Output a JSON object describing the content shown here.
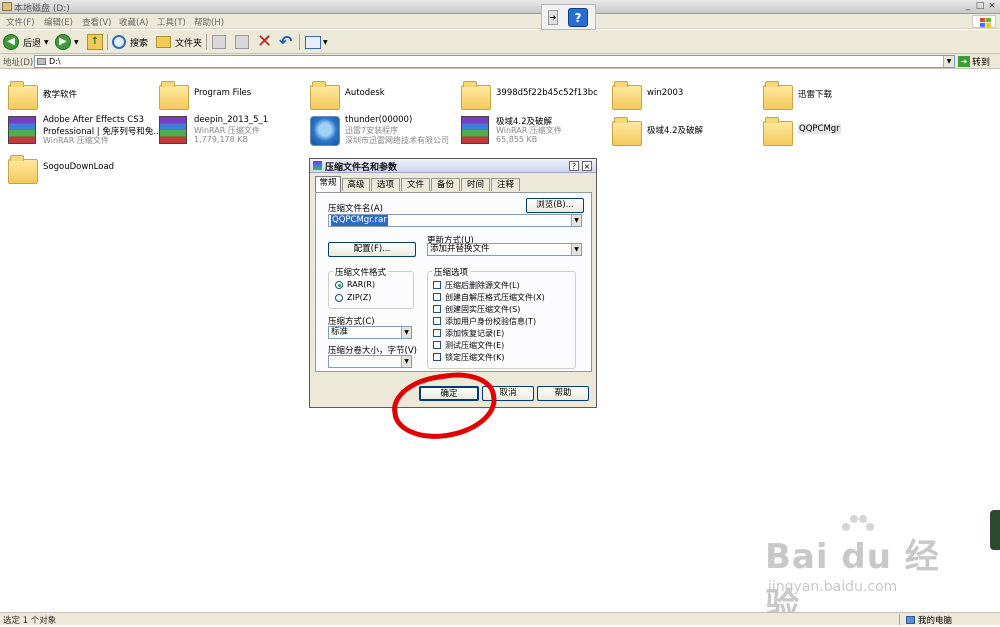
{
  "window": {
    "title": "本地磁盘 (D:)",
    "controls": [
      "_",
      "□",
      "×"
    ]
  },
  "menu": [
    "文件(F)",
    "编辑(E)",
    "查看(V)",
    "收藏(A)",
    "工具(T)",
    "帮助(H)"
  ],
  "toolbar": {
    "back_label": "后退",
    "search_label": "搜索",
    "folders_label": "文件夹"
  },
  "address": {
    "label": "地址(D)",
    "value": "D:\\",
    "go_label": "转到"
  },
  "files": [
    {
      "name": "教学软件",
      "type": "folder"
    },
    {
      "name": "Program Files",
      "type": "folder"
    },
    {
      "name": "Autodesk",
      "type": "folder"
    },
    {
      "name": "3998d5f22b45c52f13bc",
      "type": "folder"
    },
    {
      "name": "win2003",
      "type": "folder"
    },
    {
      "name": "迅雷下载",
      "type": "folder"
    },
    {
      "name": "Adobe After Effects CS3",
      "name2": "Professional | 免序列号和免...",
      "sub": "WinRAR 压缩文件",
      "type": "rar"
    },
    {
      "name": "deepin_2013_5_1",
      "sub": "WinRAR 压缩文件",
      "sub2": "1,779,178 KB",
      "type": "rar"
    },
    {
      "name": "thunder(00000)",
      "sub": "迅雷7安装程序",
      "sub2": "深圳市迅雷网络技术有限公司",
      "type": "thunder"
    },
    {
      "name": "极域4.2及破解",
      "sub": "WinRAR 压缩文件",
      "sub2": "65,855 KB",
      "type": "rar"
    },
    {
      "name": "极域4.2及破解",
      "type": "folder"
    },
    {
      "name": "QQPCMgr",
      "type": "folder"
    },
    {
      "name": "SogouDownLoad",
      "type": "folder"
    }
  ],
  "dialog": {
    "title": "压缩文件名和参数",
    "help_btn": "?",
    "close_btn": "×",
    "tabs": [
      "常规",
      "高级",
      "选项",
      "文件",
      "备份",
      "时间",
      "注释"
    ],
    "archive_name_label": "压缩文件名(A)",
    "browse_label": "浏览(B)...",
    "archive_name_value": "QQPCMgr.rar",
    "update_mode_label": "更新方式(U)",
    "update_mode_value": "添加并替换文件",
    "profiles_label": "配置(F)...",
    "format_group_label": "压缩文件格式",
    "format_rar": "RAR(R)",
    "format_zip": "ZIP(Z)",
    "method_label": "压缩方式(C)",
    "method_value": "标准",
    "volume_label": "压缩分卷大小，字节(V)",
    "volume_value": "",
    "options_group_label": "压缩选项",
    "options": [
      "压缩后删除源文件(L)",
      "创建自解压格式压缩文件(X)",
      "创建固实压缩文件(S)",
      "添加用户身份校验信息(T)",
      "添加恢复记录(E)",
      "测试压缩文件(E)",
      "锁定压缩文件(K)"
    ],
    "ok_label": "确定",
    "cancel_label": "取消",
    "help_label": "帮助"
  },
  "status": {
    "left": "选定 1 个对象",
    "right": "我的电脑"
  },
  "watermark": {
    "brand": "Bai du 经验",
    "url": "jingyan.baidu.com"
  },
  "colors": {
    "highlight_circle": "#e00000",
    "selection": "#316ac5",
    "xp_face": "#ece9d8"
  }
}
